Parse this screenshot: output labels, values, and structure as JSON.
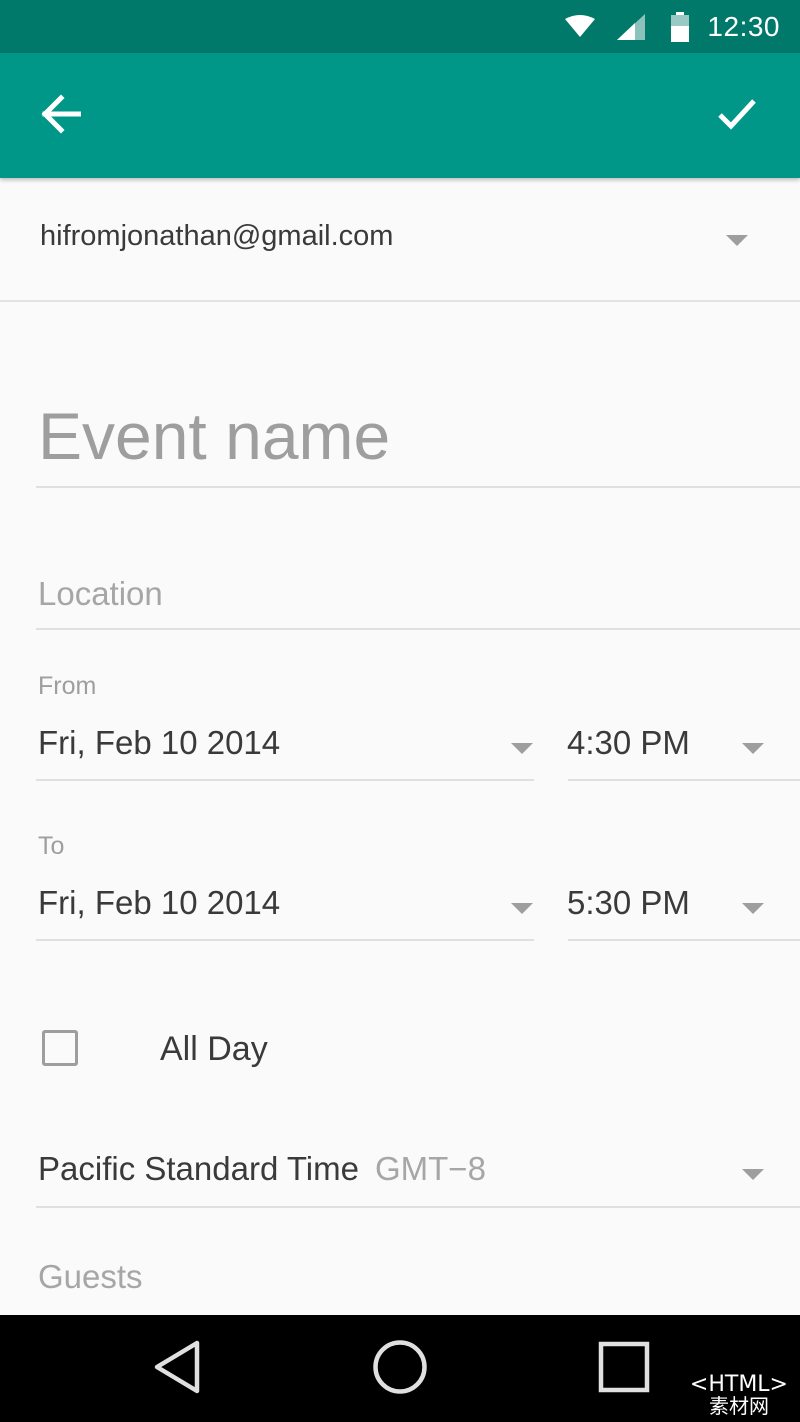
{
  "status_bar": {
    "time": "12:30",
    "icons": [
      "wifi-icon",
      "cellular-signal-icon",
      "battery-icon"
    ],
    "background": "#00796b"
  },
  "app_bar": {
    "background": "#009688",
    "left_icon": "back-arrow-icon",
    "right_icon": "check-icon"
  },
  "account": {
    "email": "hifromjonathan@gmail.com"
  },
  "form": {
    "event_name_placeholder": "Event name",
    "location_placeholder": "Location",
    "from": {
      "label": "From",
      "date": "Fri, Feb 10 2014",
      "time": "4:30 PM"
    },
    "to": {
      "label": "To",
      "date": "Fri, Feb 10 2014",
      "time": "5:30 PM"
    },
    "all_day": {
      "label": "All Day",
      "checked": false
    },
    "timezone": {
      "name": "Pacific Standard Time",
      "offset": "GMT−8"
    },
    "guests_placeholder": "Guests"
  },
  "nav_bar": {
    "icons": [
      "back-triangle-icon",
      "home-circle-icon",
      "recents-square-icon"
    ]
  },
  "watermark": {
    "top": "<HTML>",
    "bottom": "素材网"
  }
}
